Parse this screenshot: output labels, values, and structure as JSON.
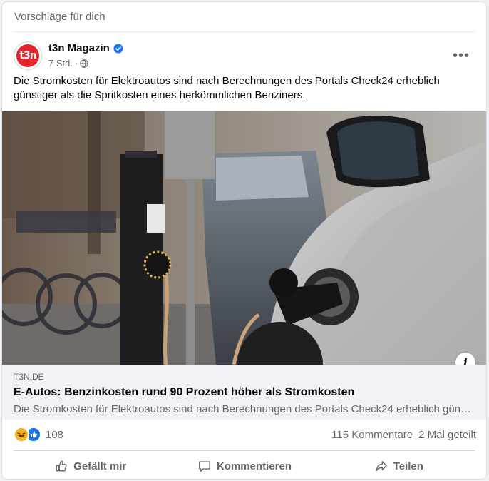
{
  "feed": {
    "section_title": "Vorschläge für dich"
  },
  "post": {
    "page_name": "t3n Magazin",
    "avatar_text": "t3n",
    "time": "7 Std.",
    "separator": "·",
    "more_label": "•••",
    "text": "Die Stromkosten für Elektroautos sind nach Berechnungen des Portals Check24 erheblich günstiger als die Spritkosten eines herkömmlichen Benziners.",
    "image_info_label": "i"
  },
  "link": {
    "domain": "T3N.DE",
    "title": "E-Autos: Benzinkosten rund 90 Prozent höher als Stromkosten",
    "description": "Die Stromkosten für Elektroautos sind nach Berechnungen des Portals Check24 erheblich günstiger als die Spritkosten eines herkömmlichen Benziners."
  },
  "stats": {
    "reactions_count": "108",
    "comments": "115 Kommentare",
    "shares": "2 Mal geteilt"
  },
  "actions": {
    "like": "Gefällt mir",
    "comment": "Kommentieren",
    "share": "Teilen"
  },
  "colors": {
    "brand": "#e3242b",
    "verified": "#1877f2",
    "haha": "#f7b125",
    "like": "#1877f2"
  },
  "icons": [
    "verified-badge-icon",
    "globe-icon",
    "more-options-icon",
    "info-icon",
    "haha-reaction-icon",
    "like-reaction-icon",
    "thumbs-up-icon",
    "comment-bubble-icon",
    "share-arrow-icon"
  ]
}
